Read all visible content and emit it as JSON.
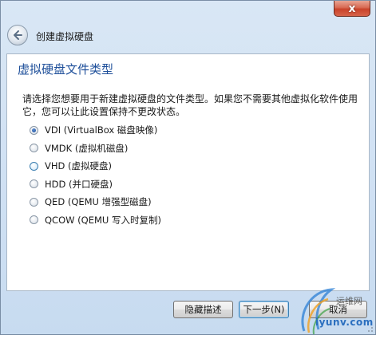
{
  "titlebar": {
    "close_glyph": "x"
  },
  "header": {
    "back_icon": "back-arrow-icon",
    "title": "创建虚拟硬盘"
  },
  "page": {
    "title": "虚拟硬盘文件类型",
    "description": "请选择您想要用于新建虚拟硬盘的文件类型。如果您不需要其他虚拟化软件使用它，您可以让此设置保持不更改状态。",
    "options": [
      {
        "label": "VDI (VirtualBox 磁盘映像)",
        "selected": true
      },
      {
        "label": "VMDK (虚拟机磁盘)",
        "selected": false
      },
      {
        "label": "VHD (虚拟硬盘)",
        "selected": false
      },
      {
        "label": "HDD (并口硬盘)",
        "selected": false
      },
      {
        "label": "QED (QEMU 增强型磁盘)",
        "selected": false
      },
      {
        "label": "QCOW (QEMU 写入时复制)",
        "selected": false
      }
    ]
  },
  "footer": {
    "hide_description": "隐藏描述",
    "next": "下一步(N)",
    "cancel": "取消"
  },
  "watermark": {
    "brand": "运维网",
    "site": "iyunv.com"
  },
  "colors": {
    "accent_title": "#1e4f9a",
    "close_button": "#c9432a",
    "window_chrome": "#cfe0f3"
  }
}
